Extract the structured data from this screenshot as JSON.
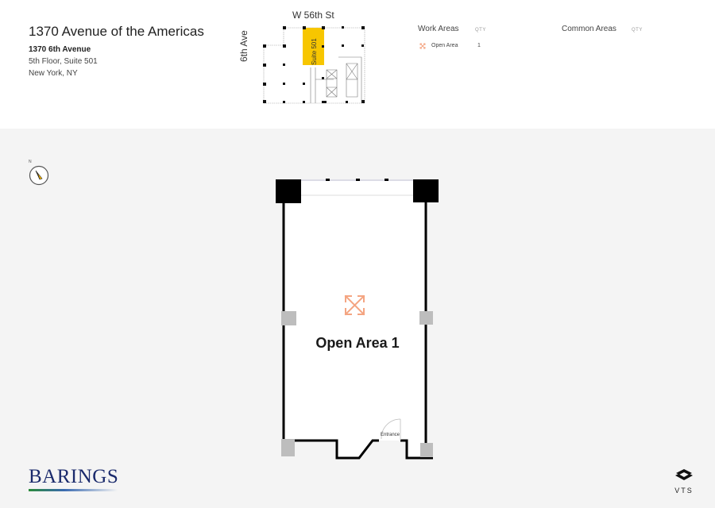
{
  "header": {
    "title": "1370 Avenue of the Americas",
    "address_line1": "1370 6th Avenue",
    "address_line2": "5th Floor, Suite 501",
    "address_line3": "New York, NY"
  },
  "keyplan": {
    "street_top": "W 56th St",
    "street_side": "6th Ave",
    "suite_label": "Suite 501",
    "highlight_color": "#f7c600"
  },
  "legend": {
    "work_areas": {
      "title": "Work Areas",
      "qty_label": "QTY",
      "items": [
        {
          "icon": "expand-arrows-icon",
          "label": "Open Area",
          "qty": "1"
        }
      ]
    },
    "common_areas": {
      "title": "Common Areas",
      "qty_label": "QTY",
      "items": []
    }
  },
  "floorplan": {
    "room_label": "Open Area 1",
    "entrance_label": "Entrance",
    "icon": "expand-arrows-icon",
    "accent_color": "#f4a582"
  },
  "compass": {
    "north_label": "N"
  },
  "logos": {
    "landlord": "BARINGS",
    "platform": "VTS"
  }
}
